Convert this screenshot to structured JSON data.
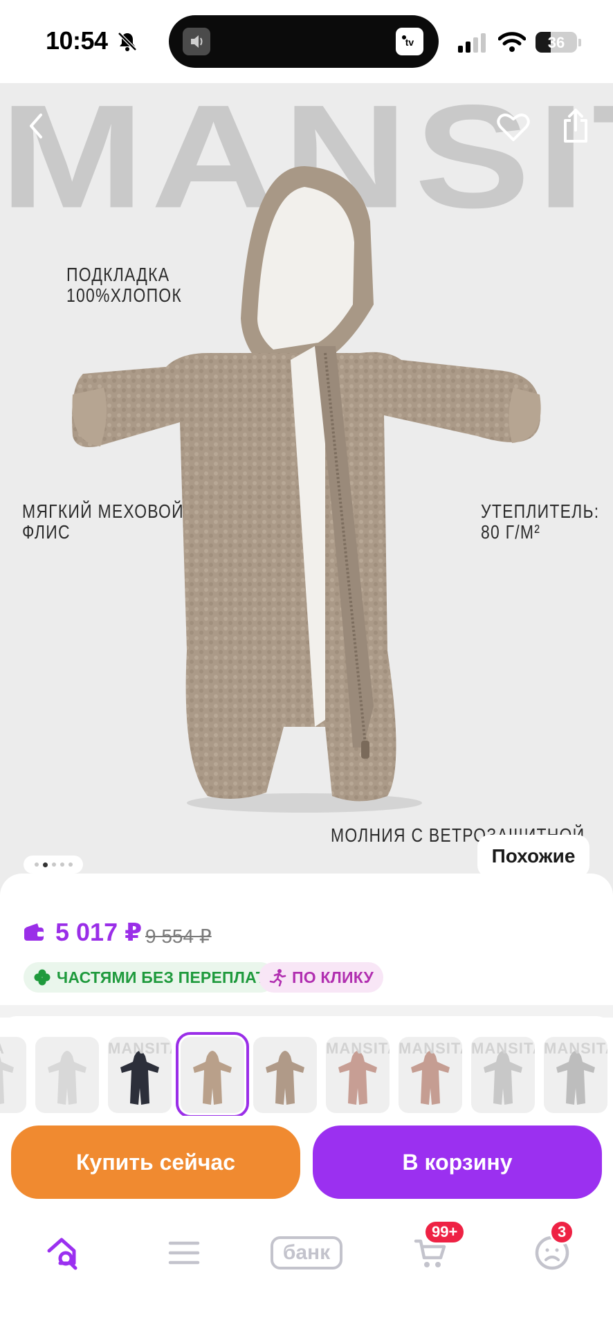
{
  "status_bar": {
    "time": "10:54",
    "battery": "36",
    "battery_level": 0.36
  },
  "hero": {
    "brand": "MANSITA",
    "features": {
      "lining_line1": "ПОДКЛАДКА",
      "lining_line2": "100%ХЛОПОК",
      "fleece_line1": "МЯГКИЙ МЕХОВОЙ",
      "fleece_line2": "ФЛИС",
      "insulation_line1": "УТЕПЛИТЕЛЬ:",
      "insulation_line2": "80 Г/М²",
      "zipper": "МОЛНИЯ С ВЕТРОЗАЩИТНОЙ"
    },
    "slide_count": 5,
    "active_slide": 2,
    "similar_label": "Похожие"
  },
  "price": {
    "current": "5 017 ₽",
    "old": "9 554 ₽",
    "installments_label": "ЧАСТЯМИ БЕЗ ПЕРЕПЛАТ",
    "one_click_label": "ПО КЛИКУ"
  },
  "thumbnails": {
    "active_index": 3,
    "items": [
      {
        "brand": "TA",
        "color": "#d6d6d6"
      },
      {
        "brand": "",
        "color": "#d8d8d8"
      },
      {
        "brand": "MANSITA",
        "color": "#2c2f3a"
      },
      {
        "brand": "",
        "color": "#b9a08a"
      },
      {
        "brand": "",
        "color": "#b09a88"
      },
      {
        "brand": "MANSITA",
        "color": "#c79e94"
      },
      {
        "brand": "MANSITA",
        "color": "#c59d92"
      },
      {
        "brand": "MANSITA",
        "color": "#c8c8c8"
      },
      {
        "brand": "MANSITA",
        "color": "#bdbdbd"
      }
    ]
  },
  "actions": {
    "buy_now": "Купить сейчас",
    "add_to_cart": "В корзину"
  },
  "bottom_nav": {
    "bank_label": "банк",
    "cart_badge": "99+",
    "profile_badge": "3",
    "accent_color": "#9b30f0"
  }
}
